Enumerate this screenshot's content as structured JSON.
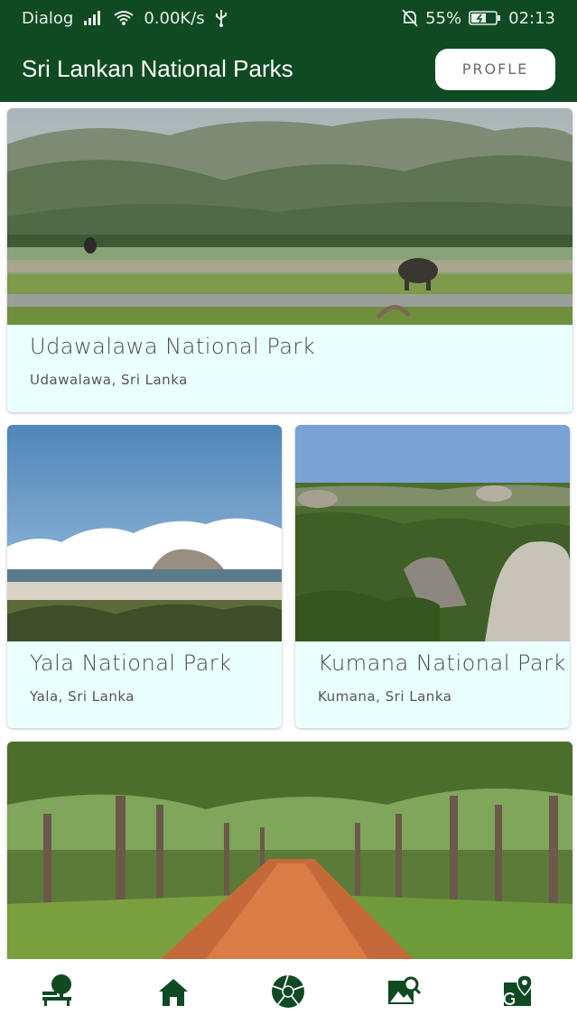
{
  "status_bar": {
    "carrier": "Dialog",
    "network_speed": "0.00K/s",
    "battery": "55%",
    "time": "02:13",
    "signal_icon": "signal-icon",
    "wifi_icon": "wifi-icon",
    "usb_icon": "usb-icon",
    "mute_icon": "bell-off-icon",
    "battery_icon": "battery-charging-icon"
  },
  "app_bar": {
    "title": "Sri Lankan National Parks",
    "profile_button": "PROFLE"
  },
  "parks": [
    {
      "name": "Udawalawa National Park",
      "location": "Udawalawa,  Sri Lanka"
    },
    {
      "name": "Yala National Park",
      "location": "Yala, Sri Lanka"
    },
    {
      "name": "Kumana National Park",
      "location": "Kumana, Sri Lanka"
    },
    {
      "name": "",
      "location": ""
    }
  ],
  "bottom_nav": [
    {
      "icon": "park-bench-icon"
    },
    {
      "icon": "home-icon"
    },
    {
      "icon": "camera-shutter-icon"
    },
    {
      "icon": "image-search-icon"
    },
    {
      "icon": "map-location-icon"
    }
  ],
  "colors": {
    "primary": "#0f4a23",
    "card_bg": "#eaffff",
    "nav_icon": "#0f4a23"
  }
}
